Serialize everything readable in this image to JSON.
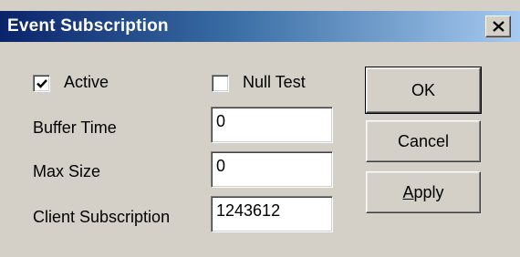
{
  "window": {
    "title": "Event Subscription"
  },
  "form": {
    "active": {
      "label": "Active",
      "checked": true
    },
    "null_test": {
      "label": "Null Test",
      "checked": false
    },
    "buffer_time": {
      "label": "Buffer Time",
      "value": "0"
    },
    "max_size": {
      "label": "Max Size",
      "value": "0"
    },
    "client_subscription": {
      "label": "Client Subscription",
      "value": "1243612"
    }
  },
  "buttons": {
    "ok": "OK",
    "cancel": "Cancel",
    "apply_mnemonic": "A",
    "apply_rest": "pply"
  },
  "icons": {
    "close": "close-icon",
    "check": "check-icon"
  },
  "colors": {
    "title_gradient_start": "#0a246a",
    "title_gradient_end": "#a6caf0",
    "face": "#d4d0c8"
  }
}
